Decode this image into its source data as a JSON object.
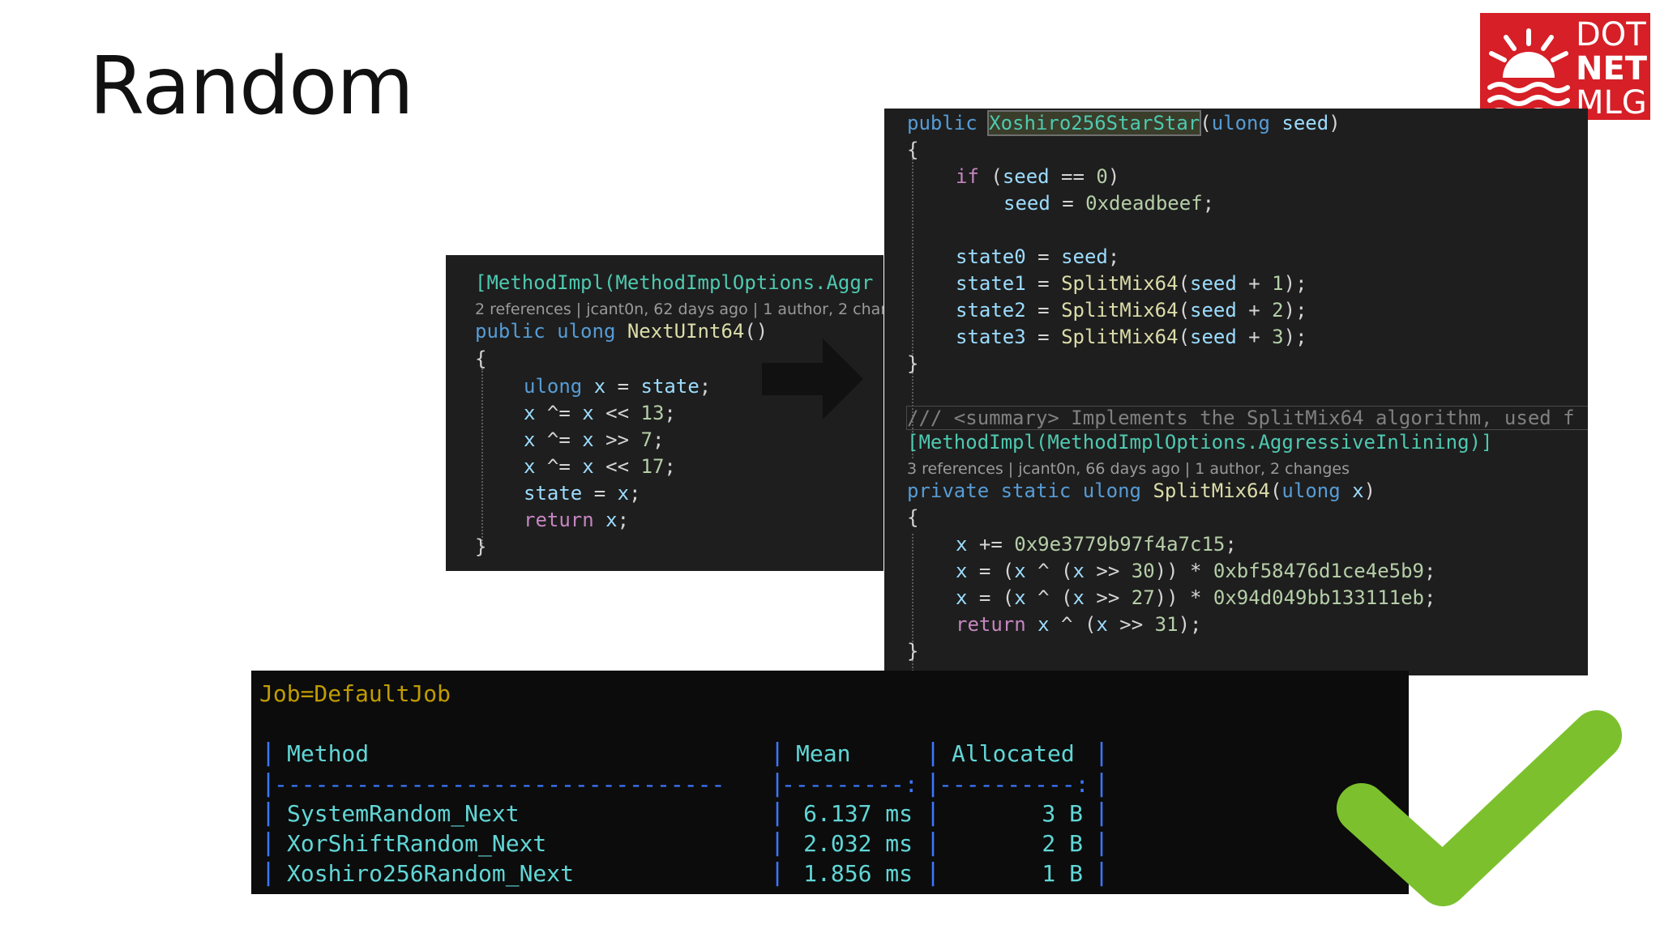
{
  "slide": {
    "title": "Random"
  },
  "logo": {
    "line1": "DOT",
    "line2": "NET",
    "line3": "MLG"
  },
  "left_panel": {
    "attribute": "[MethodImpl(MethodImplOptions.Aggr",
    "codelens": "2 references | jcant0n, 62 days ago | 1 author, 2 chan",
    "signature": {
      "k1": "public",
      "k2": "ulong",
      "name": "NextUInt64",
      "params": "()"
    },
    "open_brace": "{",
    "l1": {
      "t": "ulong",
      "v": "x",
      "eq": " = ",
      "rhs": "state",
      "end": ";"
    },
    "l2": {
      "v": "x",
      "op": " ^= ",
      "v2": "x",
      "op2": " << ",
      "n": "13",
      "end": ";"
    },
    "l3": {
      "v": "x",
      "op": " ^= ",
      "v2": "x",
      "op2": " >> ",
      "n": "7",
      "end": ";"
    },
    "l4": {
      "v": "x",
      "op": " ^= ",
      "v2": "x",
      "op2": " << ",
      "n": "17",
      "end": ";"
    },
    "l5": {
      "v": "state",
      "op": " = ",
      "v2": "x",
      "end": ";"
    },
    "l6": {
      "k": "return",
      "v": " x",
      "end": ";"
    },
    "close_brace": "}"
  },
  "right_panel": {
    "ctor": {
      "k": "public",
      "name": "Xoshiro256StarStar",
      "p1": "(",
      "pt": "ulong",
      "pn": " seed",
      "p2": ")"
    },
    "open1": "{",
    "if_line": {
      "k": "if",
      "rest1": " (",
      "v": "seed",
      "op": " == ",
      "n": "0",
      "rest2": ")"
    },
    "seed_line": {
      "v": "seed",
      "op": " = ",
      "n": "0xdeadbeef",
      "end": ";"
    },
    "s0": {
      "v": "state0",
      "op": " = ",
      "rhs": "seed",
      "end": ";"
    },
    "s1": {
      "v": "state1",
      "op": " = ",
      "fn": "SplitMix64",
      "a": "(",
      "arg": "seed",
      "plus": " + ",
      "n": "1",
      "b": ");"
    },
    "s2": {
      "v": "state2",
      "op": " = ",
      "fn": "SplitMix64",
      "a": "(",
      "arg": "seed",
      "plus": " + ",
      "n": "2",
      "b": ");"
    },
    "s3": {
      "v": "state3",
      "op": " = ",
      "fn": "SplitMix64",
      "a": "(",
      "arg": "seed",
      "plus": " + ",
      "n": "3",
      "b": ");"
    },
    "close1": "}",
    "summary": {
      "slashes": "/// ",
      "tag": "<summary>",
      "text": " Implements the SplitMix64 algorithm, used f"
    },
    "attribute": "[MethodImpl(MethodImplOptions.AggressiveInlining)]",
    "codelens": "3 references | jcant0n, 66 days ago | 1 author, 2 changes",
    "sig": {
      "k1": "private",
      "k2": " static",
      "k3": " ulong",
      "name": " SplitMix64",
      "p1": "(",
      "pt": "ulong",
      "pn": " x",
      "p2": ")"
    },
    "open2": "{",
    "m1": {
      "v": "x",
      "op": " += ",
      "n": "0x9e3779b97f4a7c15",
      "end": ";"
    },
    "m2": {
      "v": "x",
      "op": " = (",
      "v2": "x",
      "op2": " ^ (",
      "v3": "x",
      "op3": " >> ",
      "n1": "30",
      "op4": ")) * ",
      "n2": "0xbf58476d1ce4e5b9",
      "end": ";"
    },
    "m3": {
      "v": "x",
      "op": " = (",
      "v2": "x",
      "op2": " ^ (",
      "v3": "x",
      "op3": " >> ",
      "n1": "27",
      "op4": ")) * ",
      "n2": "0x94d049bb133111eb",
      "end": ";"
    },
    "m4": {
      "k": "return",
      "v": " x",
      "op": " ^ (",
      "v2": "x",
      "op2": " >> ",
      "n": "31",
      "end": ");"
    },
    "close2": "}"
  },
  "benchmark": {
    "job": "Job=DefaultJob",
    "headers": {
      "method": "Method",
      "mean": "Mean",
      "allocated": "Allocated"
    },
    "sep_method": "---------------------------------",
    "sep_mean": "---------:",
    "sep_alloc": "----------:",
    "rows": [
      {
        "method": "SystemRandom_Next",
        "mean": "6.137 ms",
        "allocated": "3 B"
      },
      {
        "method": "XorShiftRandom_Next",
        "mean": "2.032 ms",
        "allocated": "2 B"
      },
      {
        "method": "Xoshiro256Random_Next",
        "mean": "1.856 ms",
        "allocated": "1 B"
      }
    ]
  },
  "colors": {
    "logo_red": "#d61f26",
    "check_green": "#7cc12d"
  },
  "icons": {
    "arrow": "right-arrow-icon",
    "check": "checkmark-icon",
    "logo": "sun-waves-logo-icon"
  }
}
